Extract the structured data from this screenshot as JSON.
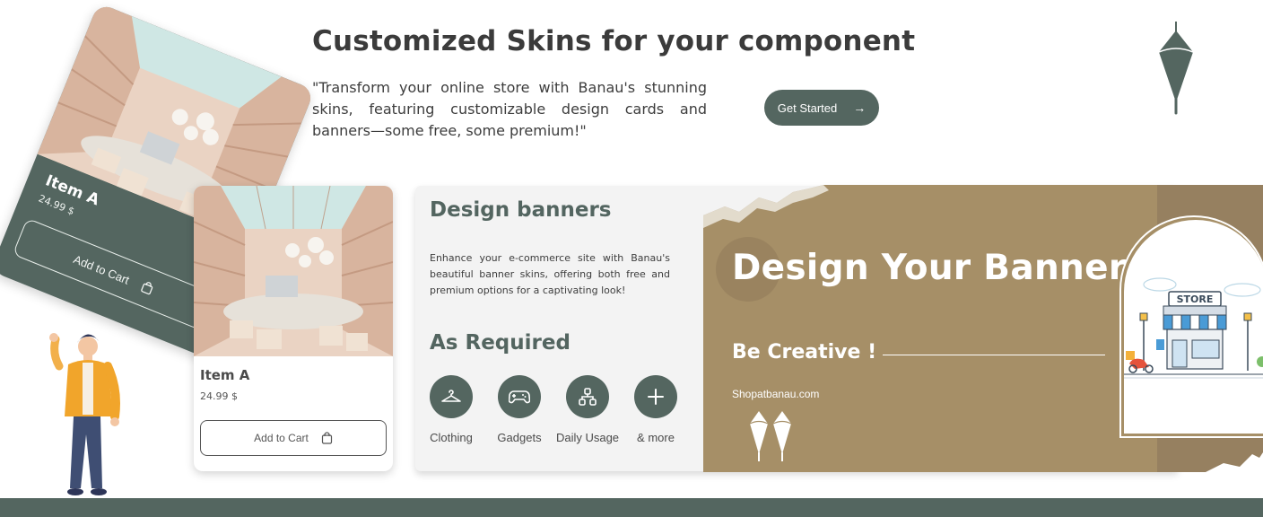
{
  "hero": {
    "title": "Customized Skins for your component",
    "text": "\"Transform your online store with Banau's stunning skins, featuring customizable design cards and banners—some free, some premium!\"",
    "cta_label": "Get Started"
  },
  "cards": [
    {
      "name": "Item A",
      "price": "24.99 $",
      "button": "Add to Cart"
    },
    {
      "name": "Item A",
      "price": "24.99 $",
      "button": "Add to Cart"
    }
  ],
  "panel": {
    "heading": "Design banners",
    "text": "Enhance your e-commerce site with Banau's beautiful banner skins, offering both free and premium options for a captivating look!",
    "required_heading": "As Required",
    "categories": [
      {
        "label": "Clothing",
        "icon": "hanger-icon"
      },
      {
        "label": "Gadgets",
        "icon": "gamepad-icon"
      },
      {
        "label": "Daily Usage",
        "icon": "network-icon"
      },
      {
        "label": "& more",
        "icon": "plus-icon"
      }
    ]
  },
  "banner": {
    "title": "Design Your Banner",
    "subtitle": "Be Creative !",
    "site": "Shopatbanau.com",
    "store_sign": "STORE"
  },
  "colors": {
    "primary": "#546660",
    "banner_tan": "#a68f67",
    "banner_dark_tan": "#968060",
    "panel_bg": "#f3f3f3"
  }
}
